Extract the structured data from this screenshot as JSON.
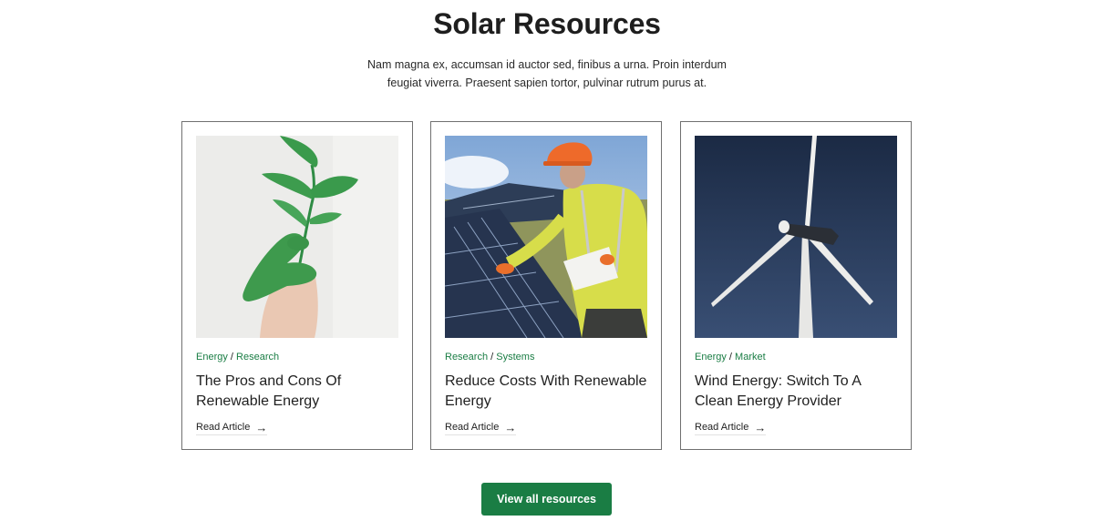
{
  "section": {
    "title": "Solar Resources",
    "description": "Nam magna ex, accumsan id auctor sed, finibus a urna. Proin interdum feugiat viverra. Praesent sapien tortor, pulvinar rutrum purus at."
  },
  "cards": [
    {
      "image": "green-painted-hand-holding-plant",
      "categories": [
        "Energy",
        "Research"
      ],
      "separator": "/",
      "title": "The Pros and Cons Of Renewable Energy",
      "link_label": "Read Article",
      "link_icon": "arrow-right-icon"
    },
    {
      "image": "worker-inspecting-solar-panels",
      "categories": [
        "Research",
        "Systems"
      ],
      "separator": "/",
      "title": "Reduce Costs With Renewable Energy",
      "link_label": "Read Article",
      "link_icon": "arrow-right-icon"
    },
    {
      "image": "wind-turbine-night-sky",
      "categories": [
        "Energy",
        "Market"
      ],
      "separator": "/",
      "title": "Wind Energy: Switch To A Clean Energy Provider",
      "link_label": "Read Article",
      "link_icon": "arrow-right-icon"
    }
  ],
  "cta": {
    "label": "View all resources"
  },
  "colors": {
    "accent": "#1a7d44",
    "text": "#1f1f1f",
    "card_border": "#707070",
    "background": "#ffffff"
  }
}
